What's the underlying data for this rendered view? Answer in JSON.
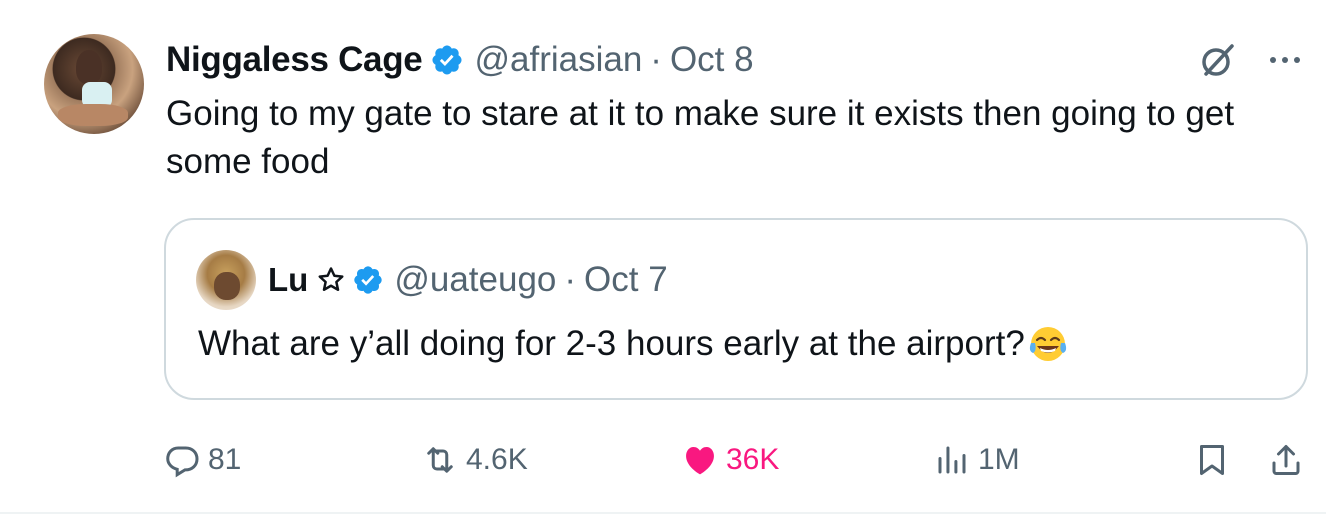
{
  "tweet": {
    "author_name": "Niggaless Cage",
    "handle": "@afriasian",
    "separator": "·",
    "date": "Oct 8",
    "text": "Going to my gate to stare at it to make sure it exists then going to get some food"
  },
  "quoted_tweet": {
    "author_name": "Lu",
    "handle": "@uateugo",
    "separator": "·",
    "date": "Oct 7",
    "text": "What are y’all doing for 2-3 hours early at the airport?",
    "emoji": "face-with-tears-of-joy"
  },
  "actions": {
    "replies": "81",
    "retweets": "4.6K",
    "likes": "36K",
    "views": "1M"
  },
  "colors": {
    "verified": "#1d9bf0",
    "like": "#f91880",
    "secondary_text": "#536471",
    "border": "#cfd9de"
  },
  "icons": [
    "verified-badge-icon",
    "grok-icon",
    "more-icon",
    "star-icon",
    "reply-icon",
    "retweet-icon",
    "heart-icon",
    "views-icon",
    "bookmark-icon",
    "share-icon"
  ]
}
